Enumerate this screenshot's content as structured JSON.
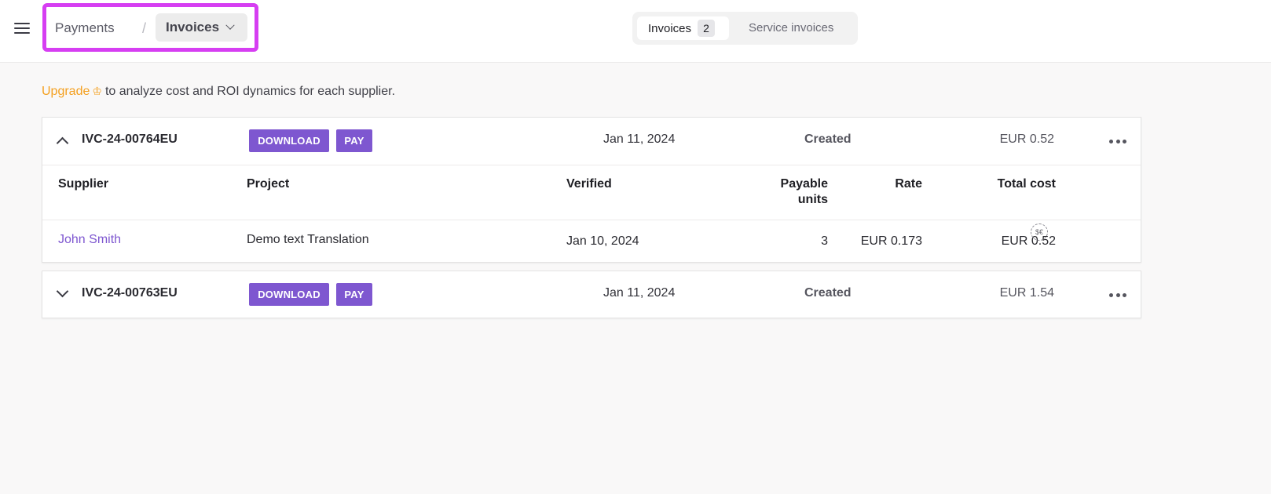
{
  "header": {
    "breadcrumb": {
      "parent": "Payments",
      "separator": "/",
      "current": "Invoices"
    },
    "tabs": [
      {
        "label": "Invoices",
        "count": "2"
      },
      {
        "label": "Service invoices"
      }
    ]
  },
  "promo": {
    "link": "Upgrade",
    "crown": "♔",
    "text": "to analyze cost and ROI dynamics for each supplier."
  },
  "invoices": [
    {
      "id": "IVC-24-00764EU",
      "download_label": "DOWNLOAD",
      "pay_label": "PAY",
      "date": "Jan 11, 2024",
      "status": "Created",
      "amount": "EUR 0.52",
      "expanded": true,
      "columns": {
        "supplier": "Supplier",
        "project": "Project",
        "verified": "Verified",
        "payable_units_1": "Payable",
        "payable_units_2": "units",
        "rate": "Rate",
        "total_cost": "Total cost"
      },
      "row": {
        "supplier": "John Smith",
        "project": "Demo text Translation",
        "verified": "Jan 10, 2024",
        "payable_units": "3",
        "rate": "EUR 0.173",
        "total_cost": "EUR 0.52",
        "icon": "currency-exchange-icon",
        "icon_text": "$€"
      }
    },
    {
      "id": "IVC-24-00763EU",
      "download_label": "DOWNLOAD",
      "pay_label": "PAY",
      "date": "Jan 11, 2024",
      "status": "Created",
      "amount": "EUR 1.54",
      "expanded": false
    }
  ],
  "colors": {
    "accent": "#7e57d0",
    "upgrade": "#f4a020",
    "highlight": "#d63ef2"
  }
}
